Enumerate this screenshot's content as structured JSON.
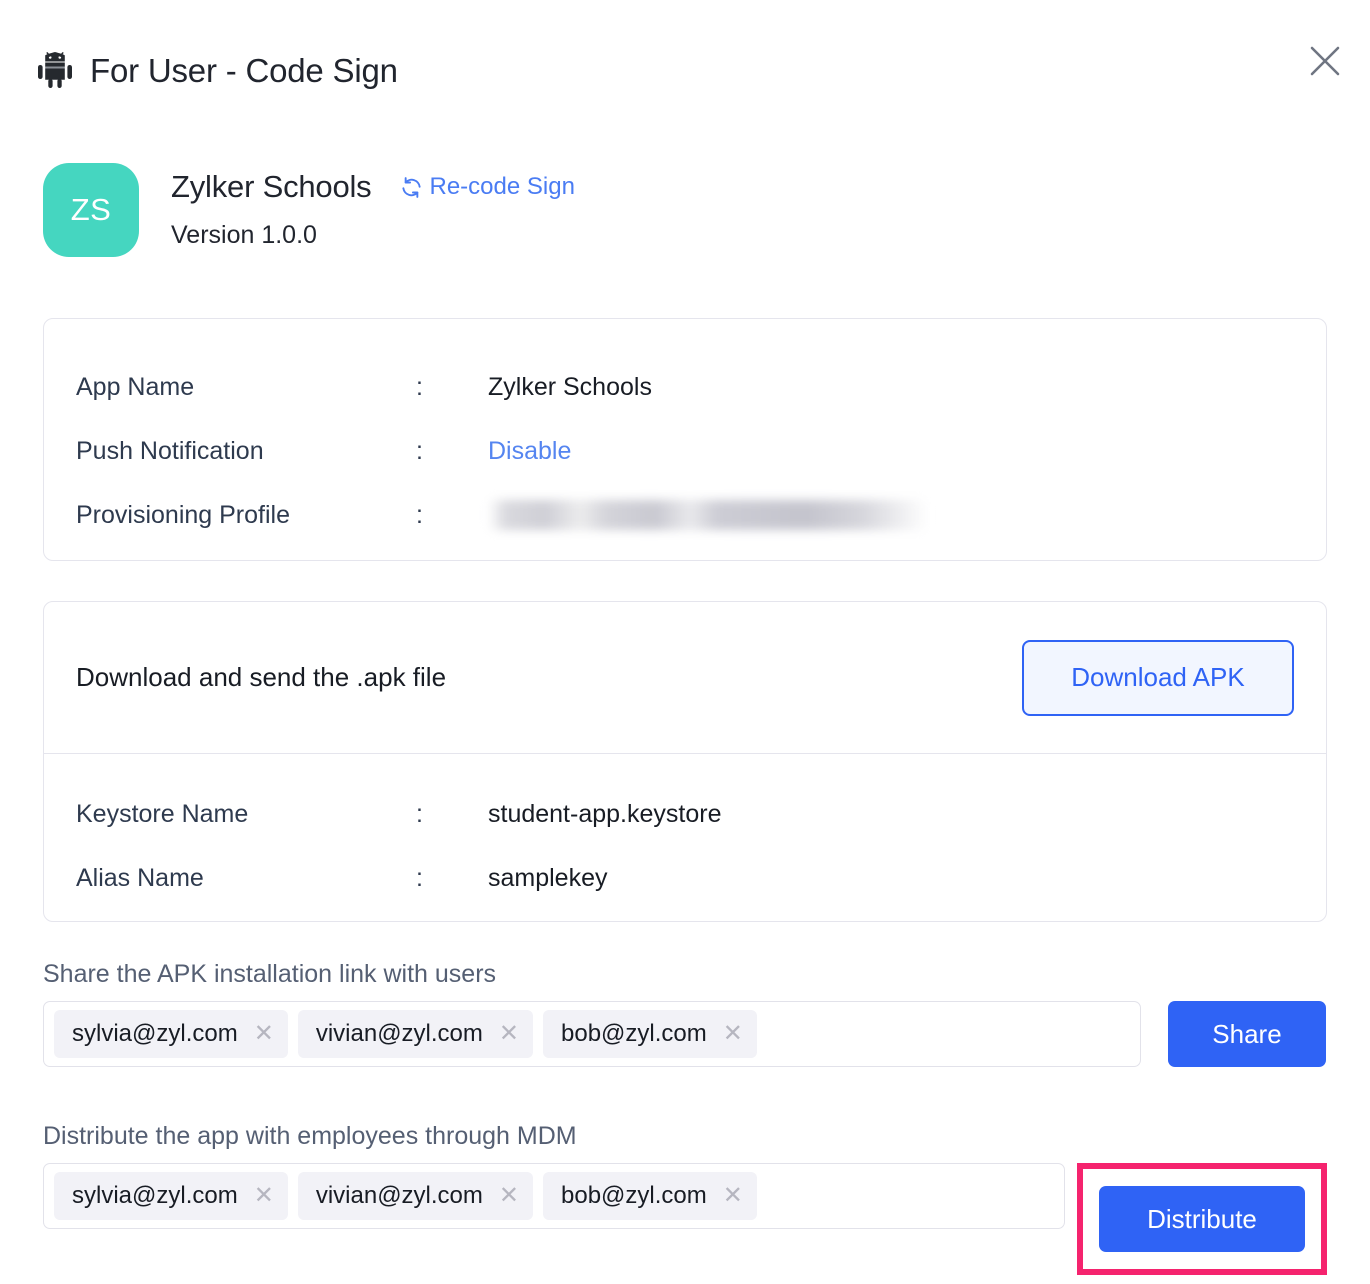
{
  "header": {
    "icon": "android-icon",
    "title": "For User - Code Sign",
    "close_icon": "close-icon"
  },
  "app": {
    "avatar_initials": "ZS",
    "avatar_color": "#45d6c0",
    "name": "Zylker Schools",
    "recode_label": "Re-code Sign",
    "recode_icon": "refresh-icon",
    "version": "Version 1.0.0"
  },
  "details_card": {
    "rows": [
      {
        "label": "App Name",
        "colon": ":",
        "value": "Zylker Schools",
        "type": "text"
      },
      {
        "label": "Push Notification",
        "colon": ":",
        "value": "Disable",
        "type": "link"
      },
      {
        "label": "Provisioning Profile",
        "colon": ":",
        "value": "",
        "type": "redacted"
      }
    ]
  },
  "download_card": {
    "text": "Download and send the .apk file",
    "button_label": "Download APK",
    "rows": [
      {
        "label": "Keystore Name",
        "colon": ":",
        "value": "student-app.keystore"
      },
      {
        "label": "Alias Name",
        "colon": ":",
        "value": "samplekey"
      }
    ]
  },
  "share_section": {
    "label": "Share the APK installation link with users",
    "chips": [
      {
        "email": "sylvia@zyl.com",
        "remove_icon": "close-icon"
      },
      {
        "email": "vivian@zyl.com",
        "remove_icon": "close-icon"
      },
      {
        "email": "bob@zyl.com",
        "remove_icon": "close-icon"
      }
    ],
    "button_label": "Share"
  },
  "distribute_section": {
    "label": "Distribute the app with employees through MDM",
    "chips": [
      {
        "email": "sylvia@zyl.com",
        "remove_icon": "close-icon"
      },
      {
        "email": "vivian@zyl.com",
        "remove_icon": "close-icon"
      },
      {
        "email": "bob@zyl.com",
        "remove_icon": "close-icon"
      }
    ],
    "button_label": "Distribute",
    "highlight_color": "#f5236e"
  },
  "colors": {
    "primary_blue": "#2f63f5",
    "link_blue": "#5585f0",
    "avatar_teal": "#45d6c0",
    "highlight_pink": "#f5236e",
    "border_gray": "#e5e5ed"
  }
}
